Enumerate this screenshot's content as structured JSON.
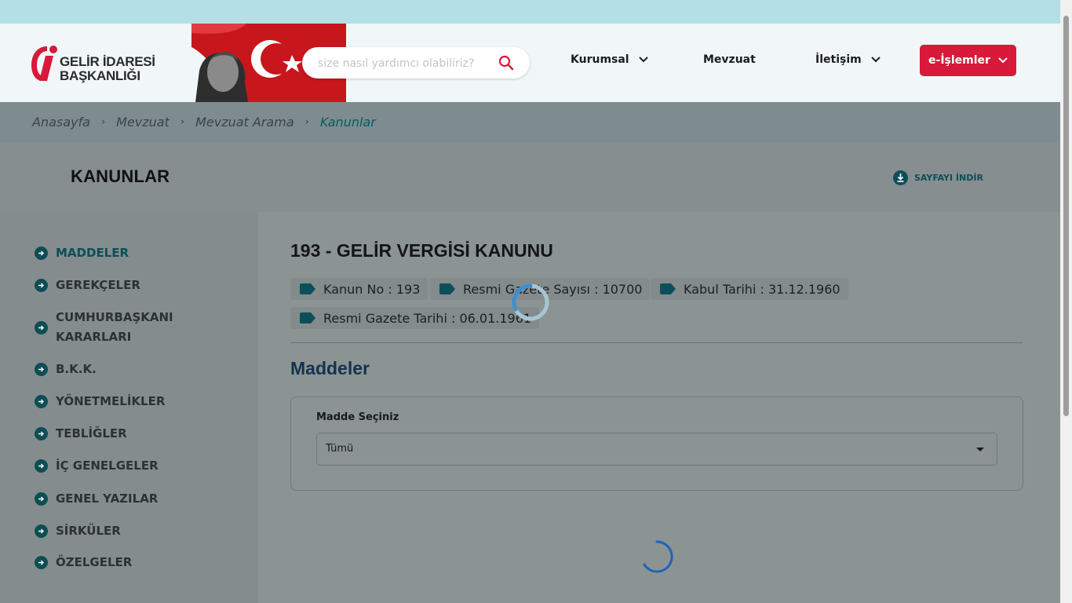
{
  "header": {
    "logo_line1": "GELİR İDARESİ",
    "logo_line2": "BAŞKANLIĞI",
    "search_placeholder": "size nasıl yardımcı olabiliriz?",
    "nav": [
      {
        "label": "Kurumsal",
        "has_dropdown": true
      },
      {
        "label": "Mevzuat",
        "has_dropdown": false
      },
      {
        "label": "İletişim",
        "has_dropdown": true
      }
    ],
    "eislemler_label": "e-İşlemler",
    "brand_color": "#d81939"
  },
  "breadcrumb": [
    "Anasayfa",
    "Mevzuat",
    "Mevzuat Arama",
    "Kanunlar"
  ],
  "page": {
    "title": "KANUNLAR",
    "download_label": "SAYFAYI İNDİR"
  },
  "sidebar": {
    "items": [
      {
        "label": "MADDELER",
        "active": true
      },
      {
        "label": "GEREKÇELER"
      },
      {
        "label": "CUMHURBAŞKANI KARARLARI"
      },
      {
        "label": "B.K.K."
      },
      {
        "label": "YÖNETMELİKLER"
      },
      {
        "label": "TEBLİĞLER"
      },
      {
        "label": "İÇ GENELGELER"
      },
      {
        "label": "GENEL YAZILAR"
      },
      {
        "label": "SİRKÜLER"
      },
      {
        "label": "ÖZELGELER"
      }
    ]
  },
  "law": {
    "title": "193 - GELİR VERGİSİ KANUNU",
    "tags": [
      "Kanun No : 193",
      "Resmi Gazete Sayısı : 10700",
      "Kabul Tarihi : 31.12.1960",
      "Resmi Gazete Tarihi : 06.01.1961"
    ]
  },
  "maddeler": {
    "section_title": "Maddeler",
    "select_label": "Madde Seçiniz",
    "select_value": "Tümü"
  }
}
